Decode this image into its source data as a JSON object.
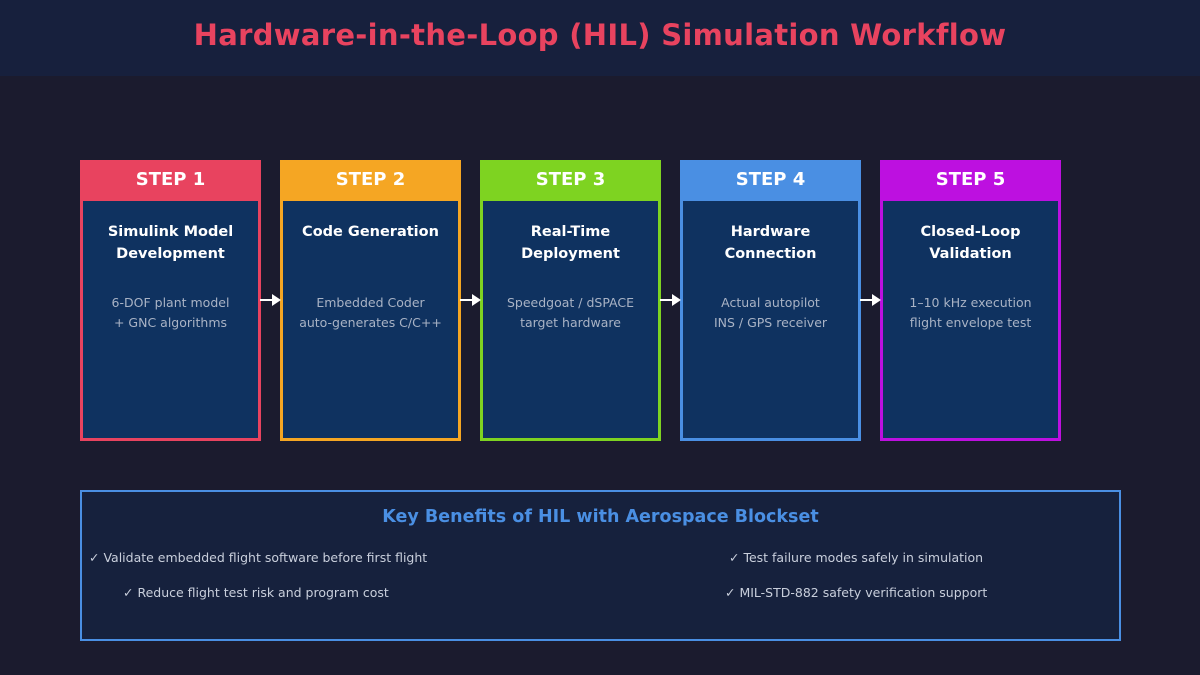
{
  "header": {
    "title": "Hardware-in-the-Loop (HIL) Simulation Workflow"
  },
  "steps": [
    {
      "label": "STEP 1",
      "title_lines": [
        "Simulink Model",
        "Development"
      ],
      "desc_lines": [
        "6-DOF plant model",
        "+ GNC algorithms"
      ],
      "color": "#e8435f"
    },
    {
      "label": "STEP 2",
      "title_lines": [
        "Code Generation",
        ""
      ],
      "desc_lines": [
        "Embedded Coder",
        "auto-generates C/C++"
      ],
      "color": "#f5a623"
    },
    {
      "label": "STEP 3",
      "title_lines": [
        "Real-Time",
        "Deployment"
      ],
      "desc_lines": [
        "Speedgoat / dSPACE",
        "target hardware"
      ],
      "color": "#7ed321"
    },
    {
      "label": "STEP 4",
      "title_lines": [
        "Hardware",
        "Connection"
      ],
      "desc_lines": [
        "Actual autopilot",
        "INS / GPS receiver"
      ],
      "color": "#4a8fe3"
    },
    {
      "label": "STEP 5",
      "title_lines": [
        "Closed-Loop",
        "Validation"
      ],
      "desc_lines": [
        "1–10 kHz execution",
        "flight envelope test"
      ],
      "color": "#bd10e0"
    }
  ],
  "benefits": {
    "title": "Key Benefits of HIL with Aerospace Blockset",
    "items": [
      "✓ Validate embedded flight software before first flight",
      "✓ Test failure modes safely in simulation",
      "✓ Reduce flight test risk and program cost",
      "✓ MIL-STD-882 safety verification support"
    ],
    "accent": "#4a8fe3"
  },
  "colors": {
    "background": "#1b1b2e",
    "header_bg": "#17203d",
    "title": "#e8435f",
    "box_fill": "#0f3260"
  }
}
